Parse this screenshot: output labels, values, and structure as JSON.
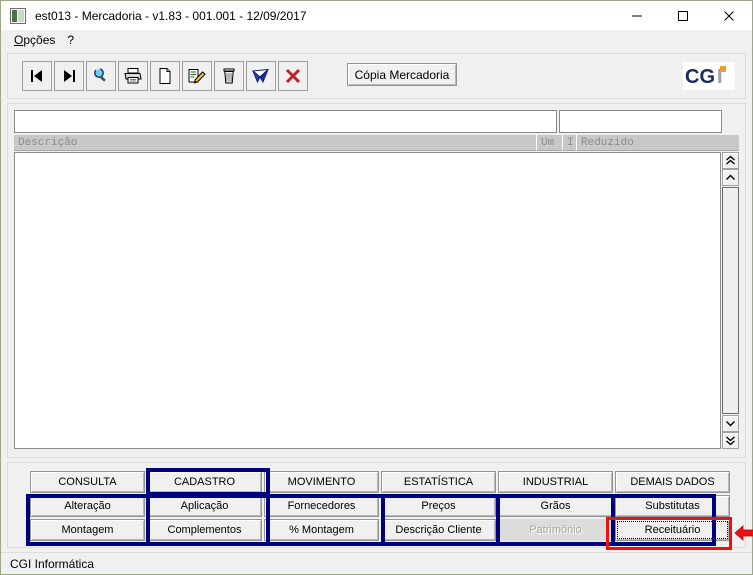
{
  "window": {
    "title": "est013 - Mercadoria - v1.83 - 001.001 - 12/09/2017",
    "app_icon": "app-icon",
    "controls": {
      "minimize": "minimize-button",
      "maximize": "maximize-button",
      "close": "close-button"
    },
    "frame_color": "#9aa889"
  },
  "menubar": {
    "items": [
      {
        "label": "Opções",
        "mnemonic": "O",
        "rest": "pções"
      },
      {
        "label": "?",
        "mnemonic": "",
        "rest": "?"
      }
    ]
  },
  "toolbar": {
    "buttons": [
      {
        "name": "first-record-icon",
        "title": "Primeiro"
      },
      {
        "name": "last-record-icon",
        "title": "Último"
      },
      {
        "name": "search-icon",
        "title": "Pesquisar"
      },
      {
        "name": "print-icon",
        "title": "Imprimir"
      },
      {
        "name": "new-document-icon",
        "title": "Novo"
      },
      {
        "name": "edit-pencil-icon",
        "title": "Alterar"
      },
      {
        "name": "trash-icon",
        "title": "Excluir"
      },
      {
        "name": "send-icon",
        "title": "Enviar"
      },
      {
        "name": "cancel-x-icon",
        "title": "Cancelar"
      }
    ],
    "copia_label": "Cópia Mercadoria",
    "logo_text": "CGI",
    "logo_colors": {
      "dark": "#1b2a5e",
      "accent": "#f0a028",
      "gray": "#9aa0ad"
    }
  },
  "grid": {
    "filter_fields": [
      {
        "name": "filter-description-input",
        "value": "",
        "placeholder": ""
      },
      {
        "name": "filter-reduzido-input",
        "value": "",
        "placeholder": ""
      }
    ],
    "columns": [
      {
        "key": "desc",
        "label": "Descrição"
      },
      {
        "key": "um",
        "label": "Um"
      },
      {
        "key": "i",
        "label": "I"
      },
      {
        "key": "red",
        "label": "Reduzido"
      }
    ],
    "rows": [],
    "scrollbar": {
      "top_double": "scroll-top-icon",
      "up": "scroll-up-icon",
      "down": "scroll-down-icon",
      "bottom_double": "scroll-bottom-icon"
    }
  },
  "button_panel": {
    "rows": [
      [
        {
          "label": "CONSULTA",
          "name": "consulta-button",
          "state": "normal"
        },
        {
          "label": "CADASTRO",
          "name": "cadastro-button",
          "state": "normal"
        },
        {
          "label": "MOVIMENTO",
          "name": "movimento-button",
          "state": "normal"
        },
        {
          "label": "ESTATÍSTICA",
          "name": "estatistica-button",
          "state": "normal"
        },
        {
          "label": "INDUSTRIAL",
          "name": "industrial-button",
          "state": "normal"
        },
        {
          "label": "DEMAIS DADOS",
          "name": "demais-dados-button",
          "state": "normal"
        }
      ],
      [
        {
          "label": "Alteração",
          "name": "alteracao-button",
          "state": "normal"
        },
        {
          "label": "Aplicação",
          "name": "aplicacao-button",
          "state": "normal"
        },
        {
          "label": "Fornecedores",
          "name": "fornecedores-button",
          "state": "normal"
        },
        {
          "label": "Preços",
          "name": "precos-button",
          "state": "normal"
        },
        {
          "label": "Grãos",
          "name": "graos-button",
          "state": "normal"
        },
        {
          "label": "Substitutas",
          "name": "substitutas-button",
          "state": "normal"
        }
      ],
      [
        {
          "label": "Montagem",
          "name": "montagem-button",
          "state": "normal"
        },
        {
          "label": "Complementos",
          "name": "complementos-button",
          "state": "normal"
        },
        {
          "label": "% Montagem",
          "name": "percent-montagem-button",
          "state": "normal"
        },
        {
          "label": "Descrição Cliente",
          "name": "descricao-cliente-button",
          "state": "normal"
        },
        {
          "label": "Patrimônio",
          "name": "patrimonio-button",
          "state": "disabled"
        },
        {
          "label": "Receituário",
          "name": "receituario-button",
          "state": "focused"
        }
      ]
    ],
    "highlight": {
      "target": "Receituário",
      "box_color": "#ee1111",
      "arrow": "left-arrow-annotation"
    },
    "group_frame_color": "#00007e"
  },
  "statusbar": {
    "text": "CGI Informática"
  }
}
